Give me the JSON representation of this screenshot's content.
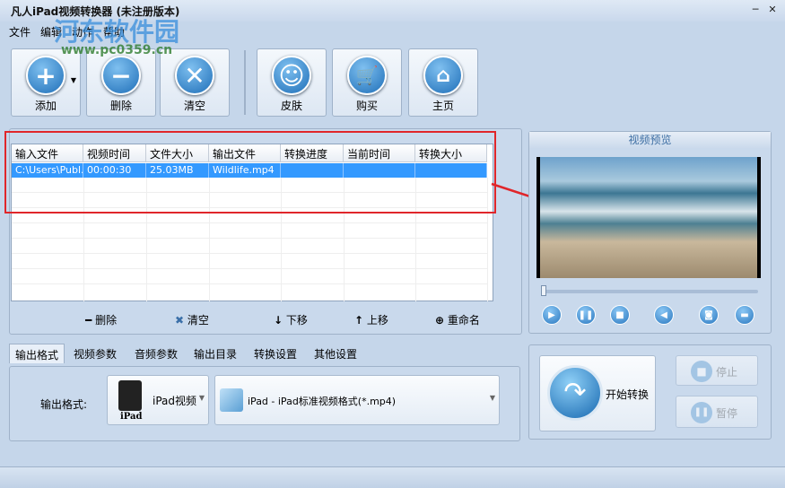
{
  "window": {
    "title": "凡人iPad视频转换器  (未注册版本)",
    "min": "─",
    "close": "✕"
  },
  "watermark": {
    "name": "河东软件园",
    "url": "www.pc0359.cn"
  },
  "menu": [
    "文件",
    "编辑",
    "动作",
    "帮助"
  ],
  "toolbar": {
    "add": "添加",
    "delete": "删除",
    "clear": "清空",
    "skin": "皮肤",
    "buy": "购买",
    "home": "主页"
  },
  "table": {
    "headers": [
      "输入文件",
      "视频时间",
      "文件大小",
      "输出文件",
      "转换进度",
      "当前时间",
      "转换大小"
    ],
    "rows": [
      [
        "C:\\Users\\Publ...",
        "00:00:30",
        "25.03MB",
        "Wildlife.mp4",
        "",
        "",
        ""
      ]
    ]
  },
  "list_actions": {
    "delete": "删除",
    "clear": "清空",
    "down": "下移",
    "up": "上移",
    "rename": "重命名"
  },
  "preview": {
    "title": "视频预览",
    "progress": 0
  },
  "tabs": [
    "输出格式",
    "视频参数",
    "音频参数",
    "输出目录",
    "转换设置",
    "其他设置"
  ],
  "format": {
    "label": "输出格式:",
    "device": "iPad视频",
    "device_caption": "iPad",
    "profile": "iPad - iPad标准视频格式(*.mp4)"
  },
  "convert": {
    "start": "开始转换",
    "stop": "停止",
    "pause": "暂停"
  }
}
